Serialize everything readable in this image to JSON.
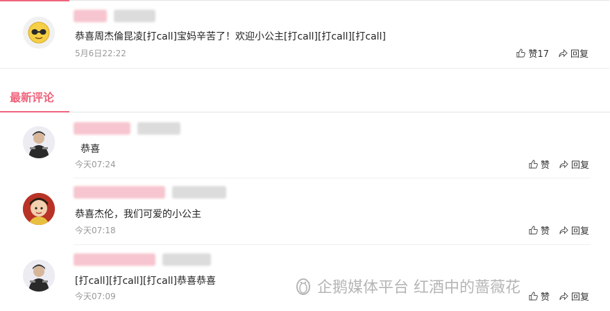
{
  "top_comment": {
    "text": "恭喜周杰倫昆凌[打call]宝妈辛苦了！欢迎小公主[打call][打call][打call]",
    "time": "5月6日22:22",
    "like_label": "赞17",
    "reply_label": "回复"
  },
  "section": {
    "title": "最新评论"
  },
  "comments": [
    {
      "text": "恭喜",
      "time": "今天07:24",
      "like_label": "赞",
      "reply_label": "回复"
    },
    {
      "text": "恭喜杰伦，我们可爱的小公主",
      "time": "今天07:18",
      "like_label": "赞",
      "reply_label": "回复"
    },
    {
      "text": "[打call][打call][打call]恭喜恭喜",
      "time": "今天07:09",
      "like_label": "赞",
      "reply_label": "回复"
    }
  ],
  "watermark": {
    "text": "企鹅媒体平台 红酒中的蔷薇花"
  },
  "colors": {
    "accent": "#f0637b",
    "time": "#999999"
  },
  "icons": {
    "like": "thumbs-up-icon",
    "reply": "share-arrow-icon",
    "watermark": "penguin-icon"
  }
}
